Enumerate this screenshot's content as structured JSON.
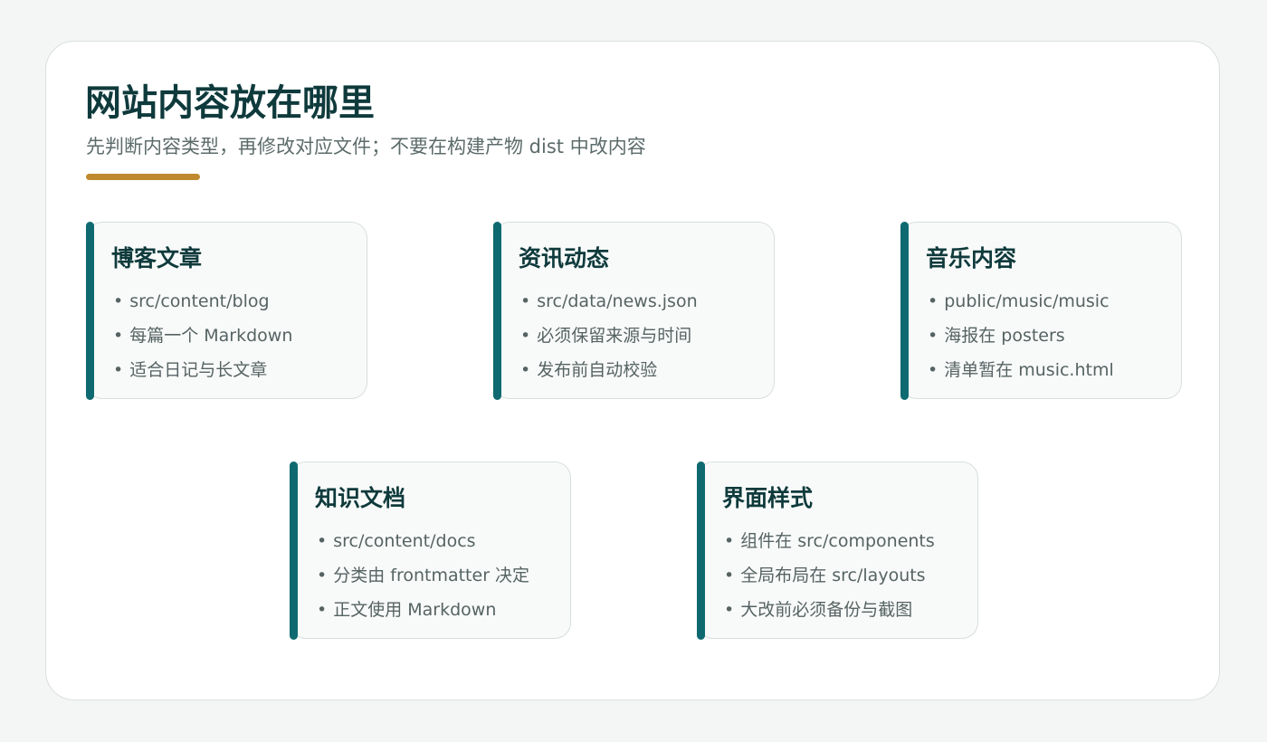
{
  "page": {
    "title": "网站内容放在哪里",
    "subtitle": "先判断内容类型，再修改对应文件；不要在构建产物 dist 中改内容"
  },
  "colors": {
    "title": "#0f3a3c",
    "accent_bar": "#c0892f",
    "card_stripe": "#0e6a70",
    "card_background": "#f8faf9"
  },
  "bullet_glyph": "•",
  "cards": [
    {
      "title": "博客文章",
      "items": [
        "src/content/blog",
        "每篇一个 Markdown",
        "适合日记与长文章"
      ]
    },
    {
      "title": "资讯动态",
      "items": [
        "src/data/news.json",
        "必须保留来源与时间",
        "发布前自动校验"
      ]
    },
    {
      "title": "音乐内容",
      "items": [
        "public/music/music",
        "海报在 posters",
        "清单暂在 music.html"
      ]
    },
    {
      "title": "知识文档",
      "items": [
        "src/content/docs",
        "分类由 frontmatter 决定",
        "正文使用 Markdown"
      ]
    },
    {
      "title": "界面样式",
      "items": [
        "组件在 src/components",
        "全局布局在 src/layouts",
        "大改前必须备份与截图"
      ]
    }
  ]
}
